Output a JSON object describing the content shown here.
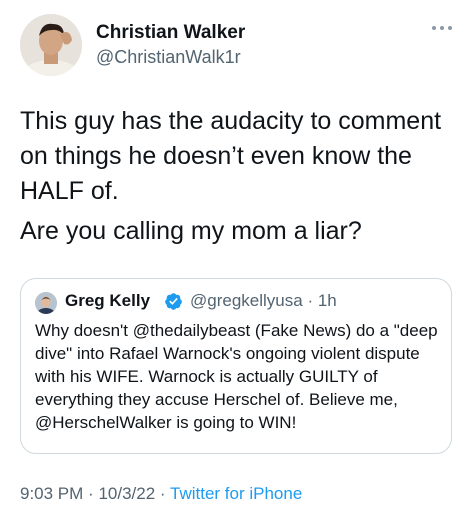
{
  "tweet": {
    "author_name": "Christian Walker",
    "author_handle": "@ChristianWalk1r",
    "text_line1": "This guy has the audacity to comment on things he doesn’t even know the HALF of.",
    "text_line2": "Are you calling my mom a liar?",
    "time": "9:03 PM",
    "separator": "·",
    "date": "10/3/22",
    "source": "Twitter for iPhone",
    "more_icon": "ellipsis-icon"
  },
  "quoted_tweet": {
    "author_name": "Greg Kelly",
    "author_handle": "@gregkellyusa",
    "time_ago": "· 1h",
    "verified_icon": "verified-badge-icon",
    "text": "Why doesn't @thedailybeast (Fake News) do a \"deep dive\" into Rafael Warnock's ongoing violent dispute with his WIFE. Warnock is actually GUILTY of everything they accuse Herschel of. Believe me, @HerschelWalker is going to WIN!"
  },
  "colors": {
    "text_primary": "#0f1419",
    "text_secondary": "#536471",
    "link": "#1d9bf0",
    "border": "#cfd9de"
  }
}
